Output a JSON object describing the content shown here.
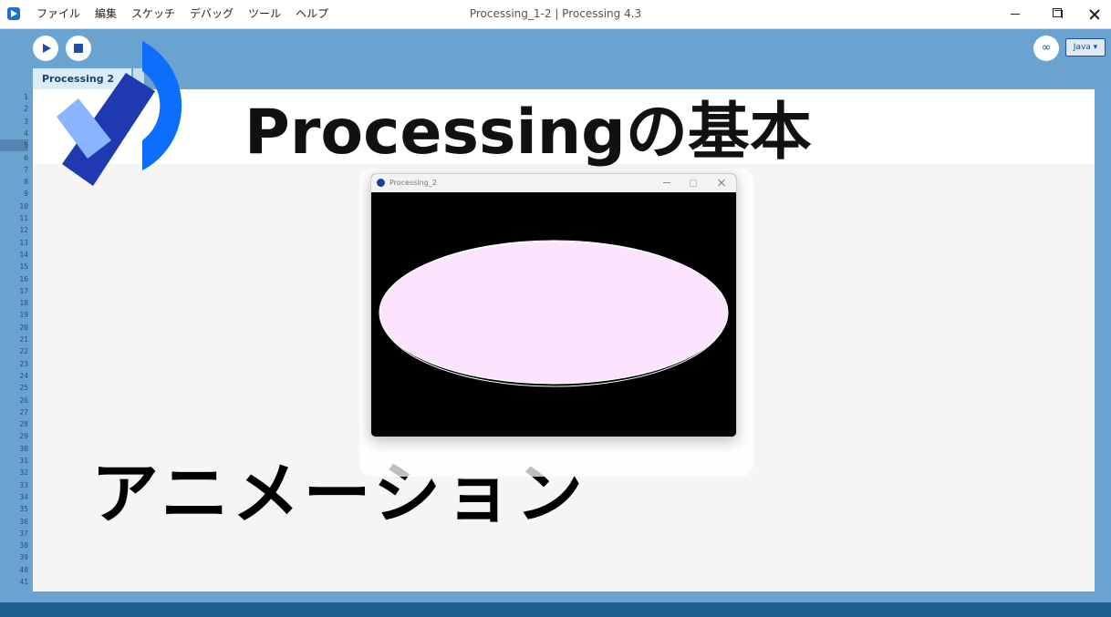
{
  "window": {
    "title": "Processing_1-2 | Processing 4.3"
  },
  "menu": {
    "items": [
      "ファイル",
      "編集",
      "スケッチ",
      "デバッグ",
      "ツール",
      "ヘルプ"
    ]
  },
  "toolbar": {
    "debug_glyph": "∞",
    "mode": "Java ▾"
  },
  "tab": {
    "label": "Processing 2"
  },
  "gutter": {
    "line_numbers": [
      "1",
      "2",
      "3",
      "4",
      "5",
      "6",
      "7",
      "8",
      "9",
      "10",
      "11",
      "12",
      "13",
      "14",
      "15",
      "16",
      "17",
      "18",
      "19",
      "20",
      "21",
      "22",
      "23",
      "24",
      "25",
      "26",
      "27",
      "28",
      "29",
      "30",
      "31",
      "32",
      "33",
      "34",
      "35",
      "36",
      "37",
      "38",
      "39",
      "40",
      "41"
    ],
    "current_line": "5"
  },
  "overlay": {
    "main_title": "Processingの基本",
    "sub_title": "アニメーション"
  },
  "sketch": {
    "title": "Processing_2",
    "background": "#000000",
    "ellipse_fill": "#fce4ff",
    "ellipse_stroke": "#ffffff"
  },
  "colors": {
    "accent": "#1e4fa8",
    "logo_blue": "#0d6efd",
    "logo_navy": "#1f3ab0",
    "logo_light": "#8ab4ff"
  }
}
